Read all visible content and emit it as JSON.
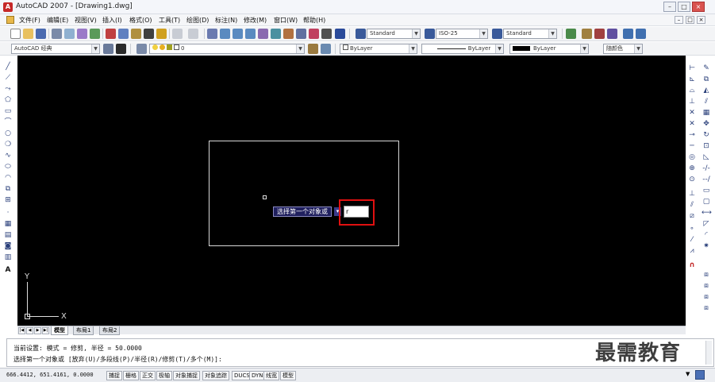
{
  "window": {
    "title": "AutoCAD 2007 - [Drawing1.dwg]",
    "app_icon_glyph": "A",
    "controls": [
      "–",
      "□",
      "×"
    ]
  },
  "menu": {
    "items": [
      "文件(F)",
      "编辑(E)",
      "视图(V)",
      "插入(I)",
      "格式(O)",
      "工具(T)",
      "绘图(D)",
      "标注(N)",
      "修改(M)",
      "窗口(W)",
      "帮助(H)"
    ],
    "doc_controls": [
      "–",
      "□",
      "×"
    ]
  },
  "toolbar1": {
    "text_style": "Standard",
    "dim_style": "ISO-25",
    "table_style": "Standard"
  },
  "toolbar2": {
    "workspace": "AutoCAD 经典",
    "layer": "0",
    "color": "ByLayer",
    "linetype": "ByLayer",
    "lineweight": "ByLayer",
    "plotstyle": "随颜色"
  },
  "drawing": {
    "dynamic_prompt": "选择第一个对象或",
    "dynamic_input_value": "r",
    "dyn_arrow": "▾",
    "ucs_x": "X",
    "ucs_y": "Y"
  },
  "layout_tabs": {
    "nav": [
      "|◀",
      "◀",
      "▶",
      "▶|"
    ],
    "tabs": [
      "模型",
      "布局1",
      "布局2"
    ],
    "active": "模型"
  },
  "command": {
    "line1": "当前设置: 模式 = 修剪, 半径 = 50.0000",
    "line2": "选择第一个对象或 [放弃(U)/多段线(P)/半径(R)/修剪(T)/多个(M)]:"
  },
  "watermark": "最需教育",
  "status": {
    "coords": "666.4412,  651.4161, 0.0000",
    "buttons": [
      "捕捉",
      "栅格",
      "正交",
      "极轴",
      "对象捕捉",
      "对象追踪",
      "DUCS",
      "DYN",
      "线宽",
      "模型"
    ],
    "tray_arrow": "▼"
  },
  "colors": {
    "canvas": "#000000",
    "highlight": "#e01010",
    "prompt_bg": "#20205e"
  }
}
